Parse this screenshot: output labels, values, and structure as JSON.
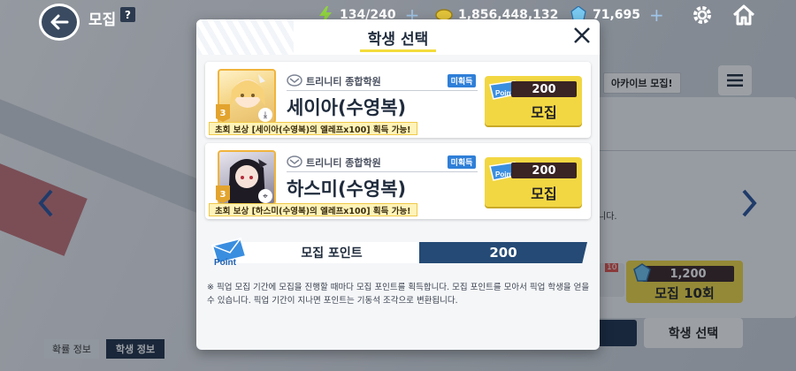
{
  "topbar": {
    "title": "모집",
    "help": "?",
    "ap": "134/240",
    "credits": "1,856,448,132",
    "gems": "71,695",
    "plus": "+"
  },
  "background": {
    "archive_badge": "아카이브 모집!",
    "partial_text": "니다.",
    "recruit10_cost": "1,200",
    "recruit10_label": "모집 10회",
    "ticket_count": "10",
    "select_student": "학생 선택",
    "tab_probability": "확률 정보",
    "tab_student_info": "학생 정보"
  },
  "modal": {
    "title": "학생 선택",
    "cards": [
      {
        "school": "트리니티 종합학원",
        "badge": "미획득",
        "name": "세이아(수영복)",
        "star": "3",
        "notice": "초회 보상 [세이아(수영복)의 엘레프x100] 획득 가능!",
        "cost": "200",
        "button": "모집"
      },
      {
        "school": "트리니티 종합학원",
        "badge": "미획득",
        "name": "하스미(수영복)",
        "star": "3",
        "notice": "초회 보상 [하스미(수영복)의 엘레프x100] 획득 가능!",
        "cost": "200",
        "button": "모집"
      }
    ],
    "points_label": "모집 포인트",
    "points_value": "200",
    "note": "※ 픽업 모집 기간에 모집을 진행할 때마다 모집 포인트를 획득합니다. 모집 포인트를 모아서 픽업 학생을 얻을 수 있습니다. 픽업 기간이 지나면 포인트는 기동석 조각으로 변환됩니다."
  },
  "colors": {
    "accent_yellow": "#f2d743",
    "navy": "#244a75",
    "badge_blue": "#2f7fd8"
  }
}
